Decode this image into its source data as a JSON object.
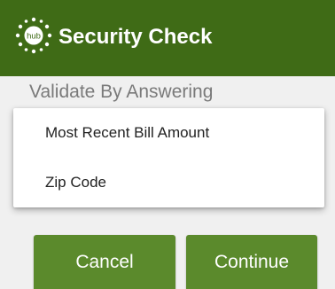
{
  "header": {
    "title": "Security Check",
    "logo_text": "hub",
    "background_color": "#3f6b16"
  },
  "validation": {
    "label": "Validate By Answering",
    "options": [
      "Most Recent Bill Amount",
      "Zip Code"
    ]
  },
  "actions": {
    "cancel_label": "Cancel",
    "continue_label": "Continue",
    "button_color": "#5b8a2c"
  }
}
